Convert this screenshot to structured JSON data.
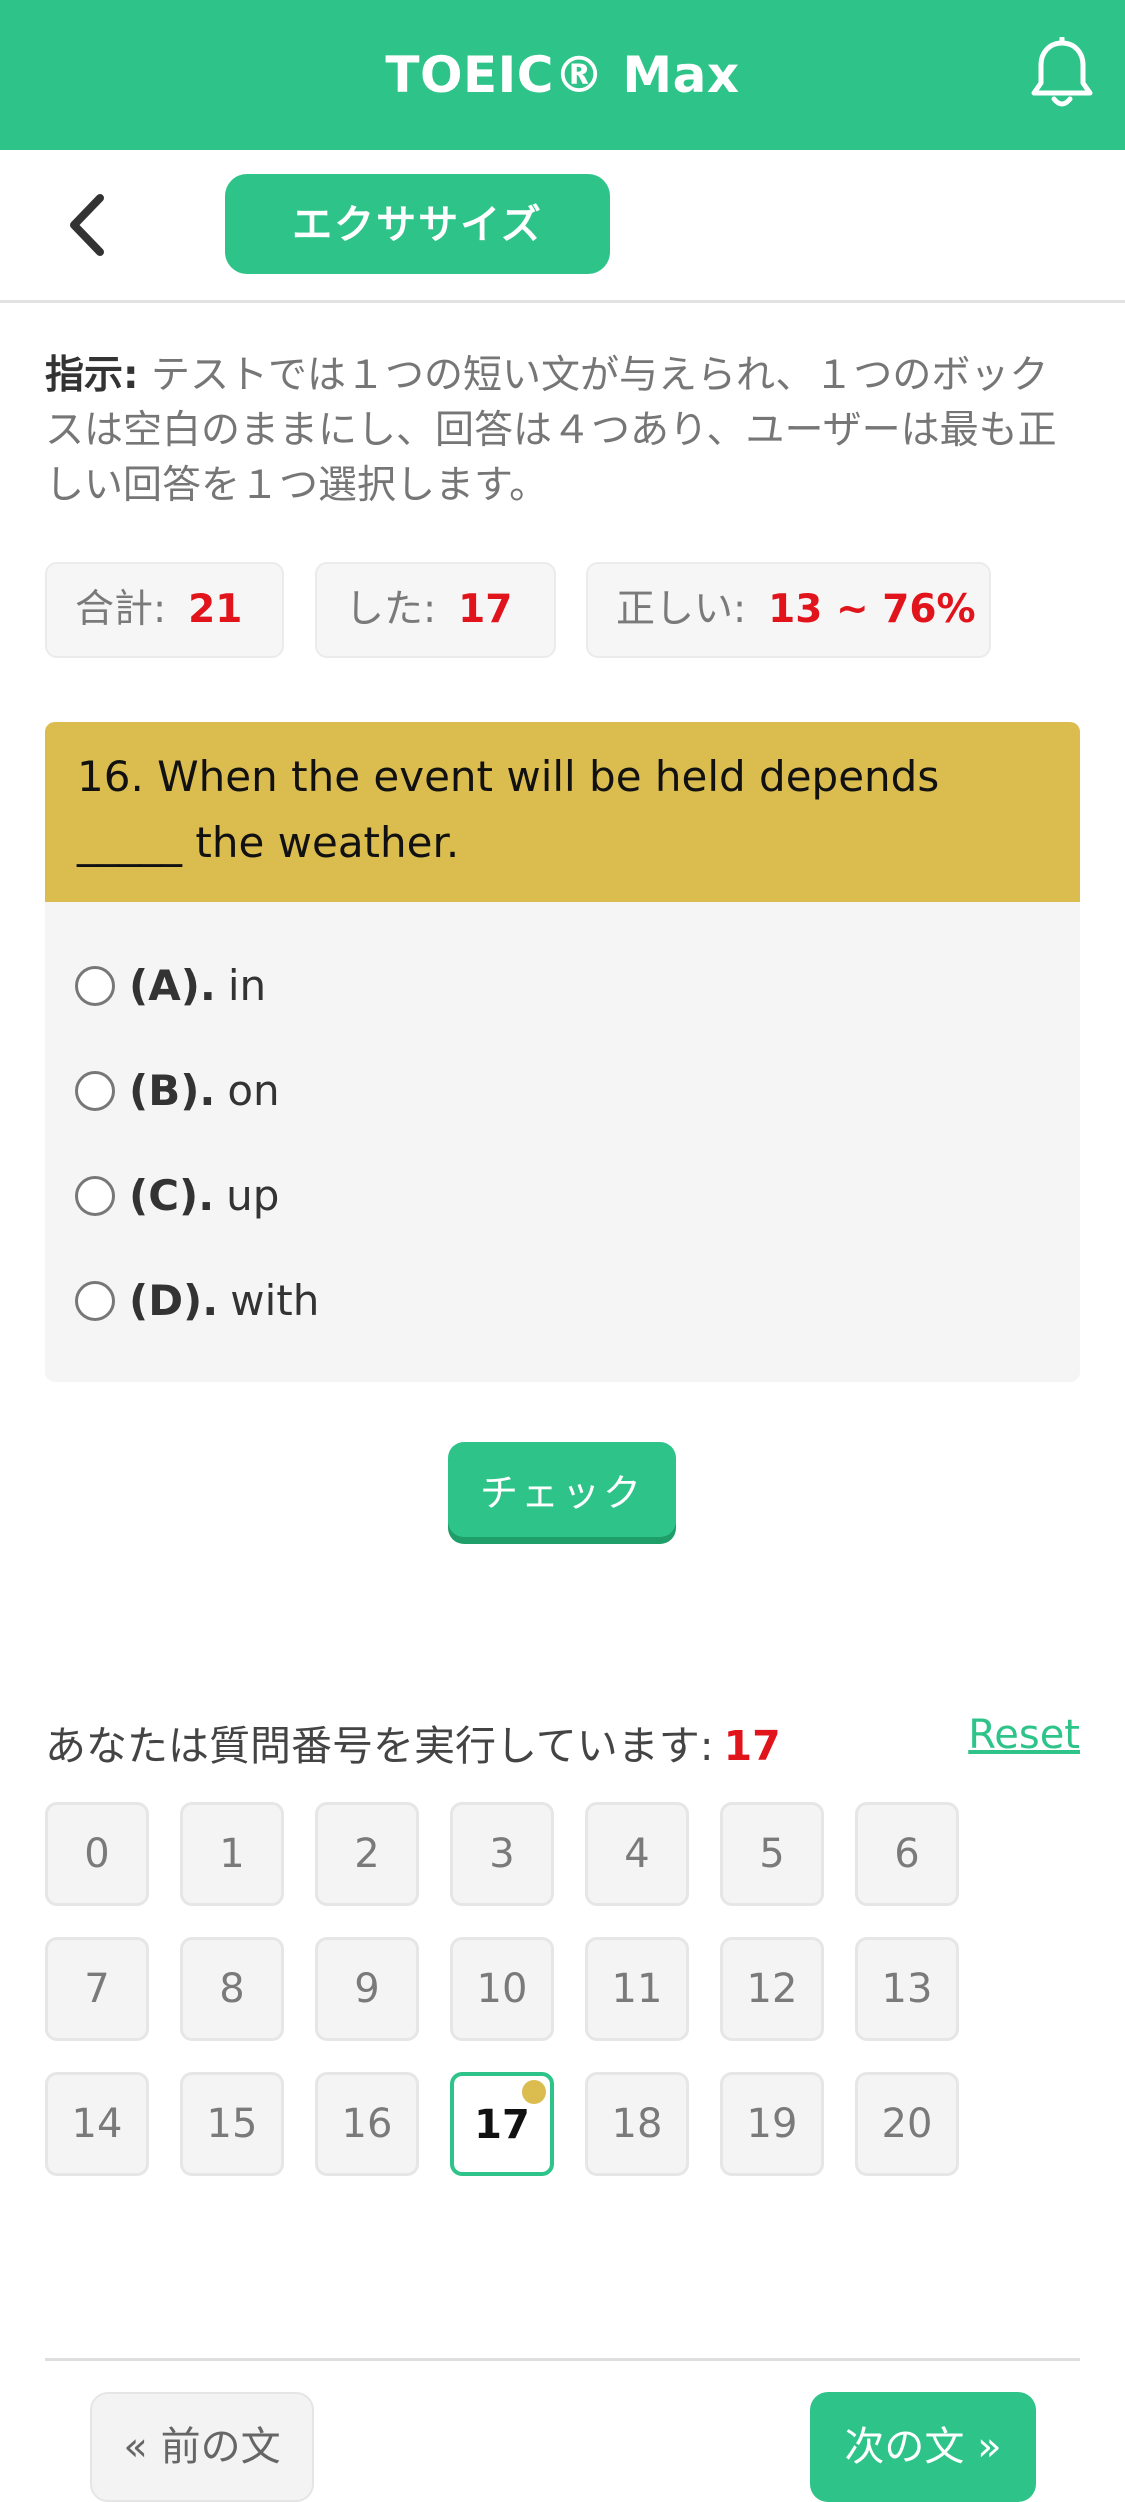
{
  "app": {
    "title": "TOEIC® Max"
  },
  "subbar": {
    "tab_label": "エクササイズ"
  },
  "instruction": {
    "label": "指示:",
    "text": " テストでは１つの短い文が与えられ、１つのボックスは空白のままにし、回答は４つあり、ユーザーは最も正しい回答を１つ選択します。"
  },
  "stats": [
    {
      "label": "合計:",
      "value": "21"
    },
    {
      "label": "した:",
      "value": "17"
    },
    {
      "label": "正しい:",
      "value": "13 ~ 76%"
    }
  ],
  "question": {
    "text": "16. When the event will be held depends _____ the weather.",
    "options": [
      {
        "key": "(A).",
        "text": "in"
      },
      {
        "key": "(B).",
        "text": "on"
      },
      {
        "key": "(C).",
        "text": "up"
      },
      {
        "key": "(D).",
        "text": "with"
      }
    ]
  },
  "check_label": "チェック",
  "progress": {
    "label": "あなたは質問番号を実行しています:",
    "current": "17",
    "reset": "Reset"
  },
  "numbers": [
    "0",
    "1",
    "2",
    "3",
    "4",
    "5",
    "6",
    "7",
    "8",
    "9",
    "10",
    "11",
    "12",
    "13",
    "14",
    "15",
    "16",
    "17",
    "18",
    "19",
    "20"
  ],
  "current_index": 17,
  "nav": {
    "prev": "« 前の文",
    "next": "次の文 »"
  },
  "colors": {
    "primary": "#2ec489",
    "accent": "#dbbd4f",
    "highlight": "#e1141c"
  },
  "icons": {
    "notification": "bell-icon",
    "back": "chevron-left-icon"
  }
}
